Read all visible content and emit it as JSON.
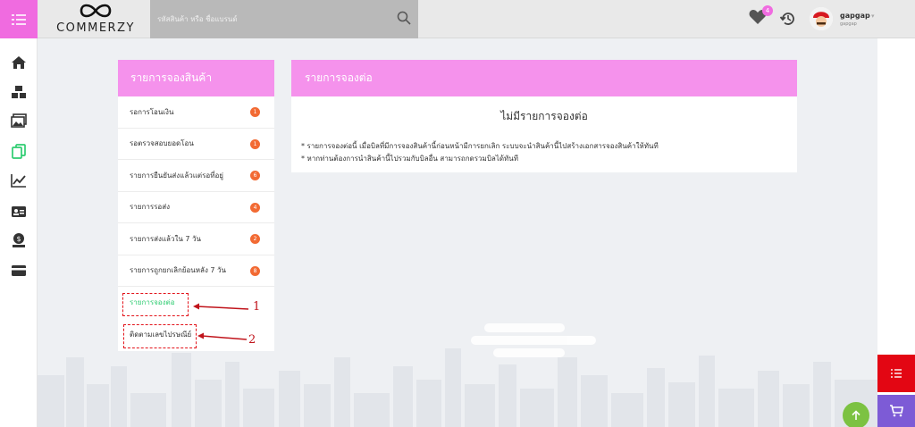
{
  "header": {
    "logo_text": "COMMERZY",
    "search_placeholder": "รหัสสินค้า หรือ ชื่อแบรนด์",
    "favorites_count": "4",
    "user_name": "gapgap",
    "user_sub": "gapgap"
  },
  "sidebar_icons": [
    "home-icon",
    "boxes-icon",
    "gallery-icon",
    "copy-icon",
    "chart-icon",
    "id-card-icon",
    "money-icon",
    "credit-card-icon"
  ],
  "left_panel": {
    "title": "รายการจองสินค้า",
    "items": [
      {
        "label": "รอการโอนเงิน",
        "count": "1"
      },
      {
        "label": "รอตรวจสอบยอดโอน",
        "count": "1"
      },
      {
        "label": "รายการยืนยันส่งแล้วแต่รอที่อยู่",
        "count": "6"
      },
      {
        "label": "รายการรอส่ง",
        "count": "4"
      },
      {
        "label": "รายการส่งแล้วใน 7 วัน",
        "count": "2"
      },
      {
        "label": "รายการถูกยกเลิกย้อนหลัง 7 วัน",
        "count": "8"
      },
      {
        "label": "รายการจองต่อ",
        "count": ""
      },
      {
        "label": "ติดตามเลขไปรษณีย์",
        "count": ""
      }
    ]
  },
  "right_panel": {
    "title": "รายการจองต่อ",
    "empty_message": "ไม่มีรายการจองต่อ",
    "note1": "* รายการจองต่อนี้ เมื่อบิลที่มีการจองสินค้านี้ก่อนหน้ามีการยกเลิก ระบบจะนำสินค้านี้ไปสร้างเอกสารจองสินค้าให้ทันที",
    "note2": "* หากท่านต้องการนำสินค้านี้ไปรวมกับบิลอื่น สามารถกดรวมบิลได้ทันที"
  },
  "annotations": {
    "one": "1",
    "two": "2"
  },
  "colors": {
    "brand_pink": "#f592ec",
    "menu_pink": "#f06be0",
    "count_badge": "#f26a33",
    "active_green": "#2ecc71",
    "annotation_red": "#e3141b"
  }
}
